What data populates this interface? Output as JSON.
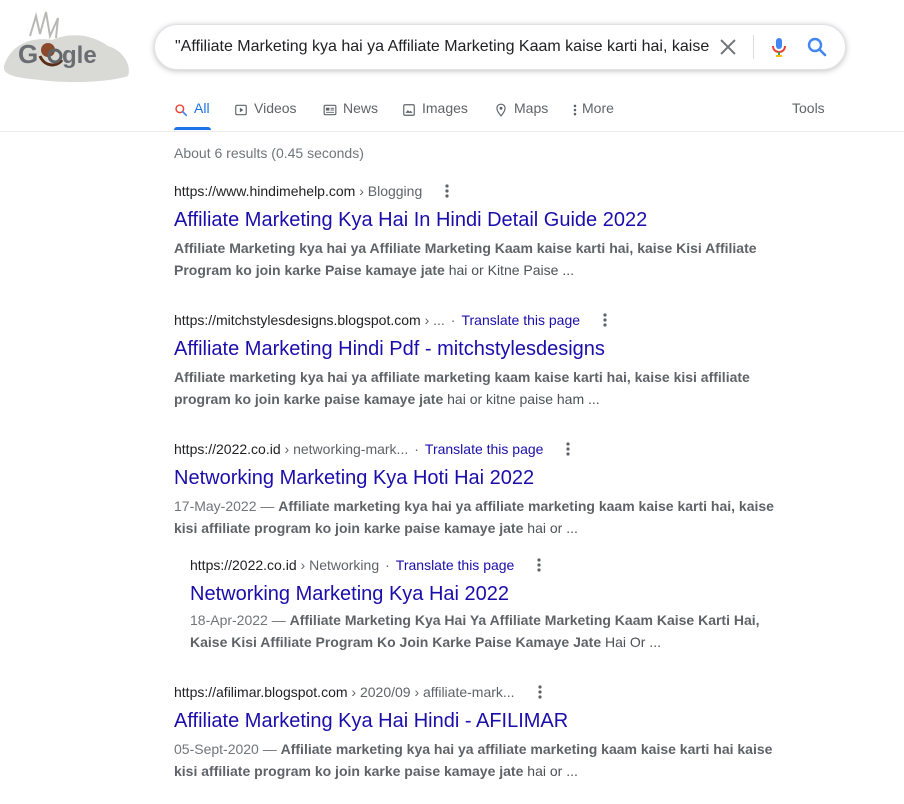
{
  "search": {
    "query": "\"Affiliate Marketing kya hai ya Affiliate Marketing Kaam kaise karti hai, kaise"
  },
  "logo": {
    "text": "Google"
  },
  "tabs": [
    {
      "label": "All",
      "icon": "search-icon",
      "active": true
    },
    {
      "label": "Videos",
      "icon": "video-icon"
    },
    {
      "label": "News",
      "icon": "news-icon"
    },
    {
      "label": "Images",
      "icon": "image-icon"
    },
    {
      "label": "Maps",
      "icon": "map-pin-icon"
    },
    {
      "label": "More",
      "icon": "more-vert-icon"
    }
  ],
  "tools_label": "Tools",
  "stats": "About 6 results (0.45 seconds)",
  "results": [
    {
      "url": "https://www.hindimehelp.com",
      "crumb": "› Blogging",
      "title": "Affiliate Marketing Kya Hai In Hindi Detail Guide 2022",
      "snippet_bold": "Affiliate Marketing kya hai ya Affiliate Marketing Kaam kaise karti hai, kaise Kisi Affiliate Program ko join karke Paise kamaye jate",
      "snippet_rest": " hai or Kitne Paise ..."
    },
    {
      "url": "https://mitchstylesdesigns.blogspot.com",
      "crumb": "› ...",
      "translate": "Translate this page",
      "title": "Affiliate Marketing Hindi Pdf - mitchstylesdesigns",
      "snippet_bold": "Affiliate marketing kya hai ya affiliate marketing kaam kaise karti hai, kaise kisi affiliate program ko join karke paise kamaye jate",
      "snippet_rest": " hai or kitne paise ham ..."
    },
    {
      "url": "https://2022.co.id",
      "crumb": "› networking-mark...",
      "translate": "Translate this page",
      "title": "Networking Marketing Kya Hoti Hai 2022",
      "date": "17-May-2022 — ",
      "snippet_bold": "Affiliate marketing kya hai ya affiliate marketing kaam kaise karti hai, kaise kisi affiliate program ko join karke paise kamaye jate",
      "snippet_rest": " hai or ..."
    },
    {
      "url": "https://2022.co.id",
      "crumb": "› Networking",
      "translate": "Translate this page",
      "title": "Networking Marketing Kya Hai 2022",
      "date": "18-Apr-2022 — ",
      "snippet_bold": "Affiliate Marketing Kya Hai Ya Affiliate Marketing Kaam Kaise Karti Hai, Kaise Kisi Affiliate Program Ko Join Karke Paise Kamaye Jate",
      "snippet_rest": " Hai Or ..."
    },
    {
      "url": "https://afilimar.blogspot.com",
      "crumb": "› 2020/09 › affiliate-mark...",
      "title": "Affiliate Marketing Kya Hai Hindi - AFILIMAR",
      "date": "05-Sept-2020 — ",
      "snippet_bold": "Affiliate marketing kya hai ya affiliate marketing kaam kaise karti hai kaise kisi affiliate program ko join karke paise kamaye jate",
      "snippet_rest": " hai or ..."
    }
  ],
  "colors": {
    "link": "#1a0dab",
    "accent": "#1a73e8",
    "text": "#202124",
    "muted": "#5f6368"
  }
}
